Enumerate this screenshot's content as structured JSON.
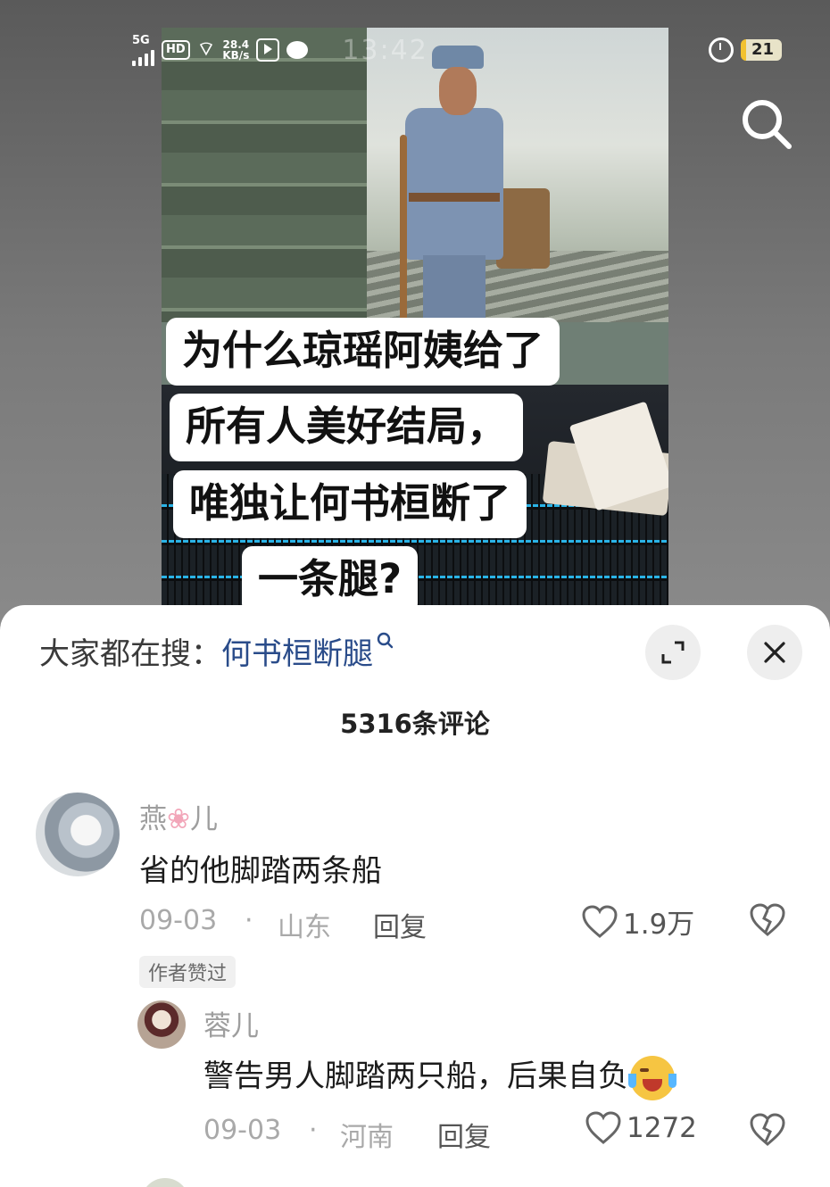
{
  "status_bar": {
    "network": "5G",
    "hd": "HD",
    "speed_value": "28.4",
    "speed_unit": "KB/s",
    "time": "13:42",
    "battery": "21"
  },
  "video": {
    "caption_lines": [
      "为什么琼瑶阿姨给了",
      "所有人美好结局，",
      "唯独让何书桓断了",
      "一条腿?"
    ]
  },
  "search": {
    "trend_label": "大家都在搜：",
    "trend_term": "何书桓断腿"
  },
  "comments_header": {
    "count": "5316条评论"
  },
  "comments": [
    {
      "user": "燕",
      "user_suffix": "儿",
      "text": "省的他脚踏两条船",
      "date": "09-03",
      "sep": "·",
      "location": "山东",
      "reply": "回复",
      "likes": "1.9万",
      "tag": "作者赞过"
    },
    {
      "user": "蓉儿",
      "text": "警告男人脚踏两只船，后果自负",
      "date": "09-03",
      "sep": "·",
      "location": "河南",
      "reply": "回复",
      "likes": "1272"
    }
  ],
  "colors": {
    "sheet_bg": "#ffffff",
    "link": "#2a4c8a",
    "muted": "#a9a9a9",
    "battery_accent": "#f2c230"
  }
}
